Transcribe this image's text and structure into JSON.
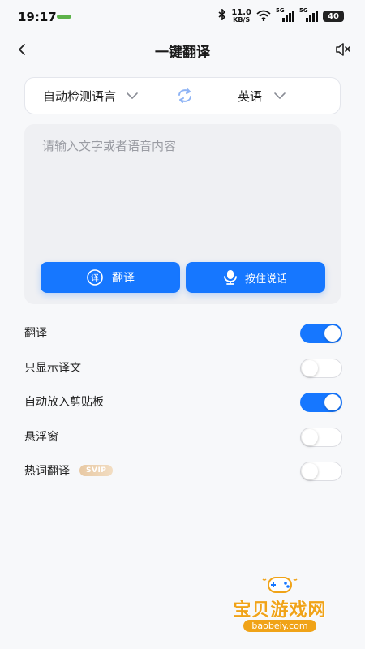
{
  "status_bar": {
    "time": "19:17",
    "network_speed_value": "11.0",
    "network_speed_unit": "KB/S",
    "signal_1_label": "5G",
    "signal_2_label": "5G",
    "battery": "40"
  },
  "header": {
    "title": "一键翻译"
  },
  "language_bar": {
    "source_language": "自动检测语言",
    "target_language": "英语"
  },
  "input": {
    "value": "",
    "placeholder": "请输入文字或者语音内容"
  },
  "actions": {
    "translate_label": "翻译",
    "voice_label": "按住说话",
    "translate_icon_glyph": "译"
  },
  "settings": [
    {
      "label": "翻译",
      "enabled": true
    },
    {
      "label": "只显示译文",
      "enabled": false
    },
    {
      "label": "自动放入剪贴板",
      "enabled": true
    },
    {
      "label": "悬浮窗",
      "enabled": false
    },
    {
      "label": "热词翻译",
      "enabled": false,
      "badge": "SVIP"
    }
  ],
  "watermark": {
    "title": "宝贝游戏网",
    "url": "baobeiy.com"
  },
  "colors": {
    "accent": "#1677ff",
    "page_background": "#f7f8fa",
    "input_background": "#eff0f3",
    "watermark": "#f0a318"
  }
}
